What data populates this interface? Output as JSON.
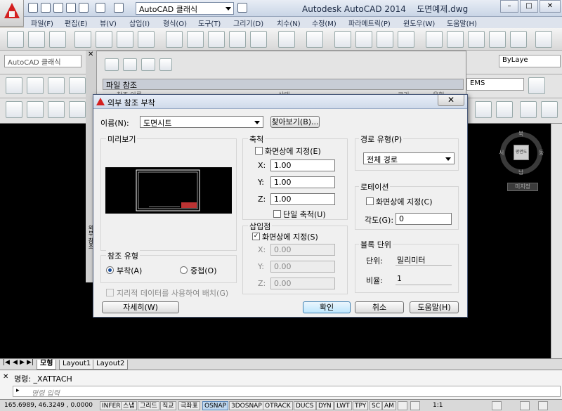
{
  "window": {
    "app_name": "Autodesk AutoCAD 2014",
    "file_name": "도면예제.dwg",
    "workspace": "AutoCAD 클래식"
  },
  "menu": [
    "파일(F)",
    "편집(E)",
    "뷰(V)",
    "삽입(I)",
    "형식(O)",
    "도구(T)",
    "그리기(D)",
    "치수(N)",
    "수정(M)",
    "파라메트릭(P)",
    "윈도우(W)",
    "도움말(H)"
  ],
  "toolbar2": {
    "workspace_select": "AutoCAD 클래식",
    "linetype_select": "ByLaye"
  },
  "toolbar3": {
    "dimstyle_select": "EMS"
  },
  "palette": {
    "header": "파일 참조",
    "col_name": "참조 이름",
    "col_status": "상태",
    "col_size": "크기",
    "col_type": "유형",
    "side_label": "외부 참조"
  },
  "viewcube": {
    "north": "북",
    "south": "남",
    "west": "서",
    "east": "동",
    "top_face": "평면도",
    "ucs": "미지정"
  },
  "dialog": {
    "title": "외부 참조 부착",
    "name_label": "이름(N):",
    "name_value": "도면시트",
    "browse_button": "찾아보기(B)...",
    "preview_label": "미리보기",
    "scale": {
      "label": "축척",
      "specify_on_screen": "화면상에 지정(E)",
      "x_label": "X:",
      "x_value": "1.00",
      "y_label": "Y:",
      "y_value": "1.00",
      "z_label": "Z:",
      "z_value": "1.00",
      "uniform": "단일 축척(U)"
    },
    "insertion": {
      "label": "삽입점",
      "specify_on_screen": "화면상에 지정(S)",
      "x_label": "X:",
      "x_value": "0.00",
      "y_label": "Y:",
      "y_value": "0.00",
      "z_label": "Z:",
      "z_value": "0.00"
    },
    "path_type": {
      "label": "경로 유형(P)",
      "value": "전체 경로"
    },
    "rotation": {
      "label": "로테이션",
      "specify_on_screen": "화면상에 지정(C)",
      "angle_label": "각도(G):",
      "angle_value": "0"
    },
    "block_unit": {
      "label": "블록 단위",
      "unit_label": "단위:",
      "unit_value": "밀리미터",
      "factor_label": "비율:",
      "factor_value": "1"
    },
    "ref_type": {
      "label": "참조 유형",
      "attach": "부착(A)",
      "overlay": "중첩(O)"
    },
    "geo_checkbox": "지리적 데이터를 사용하여 배치(G)",
    "details_button": "자세히(W)",
    "ok_button": "확인",
    "cancel_button": "취소",
    "help_button": "도움말(H)"
  },
  "tabs": [
    "모형",
    "Layout1",
    "Layout2"
  ],
  "command": {
    "history": "명령: _XATTACH",
    "placeholder": "명령 입력"
  },
  "status": {
    "coords": "165.6989, 46.3249 , 0.0000",
    "buttons": [
      "INFER",
      "스냅",
      "그리드",
      "직교",
      "극좌표",
      "OSNAP",
      "3DOSNAP",
      "OTRACK",
      "DUCS",
      "DYN",
      "LWT",
      "TPY",
      "SC",
      "AM"
    ],
    "scale": "1:1"
  }
}
